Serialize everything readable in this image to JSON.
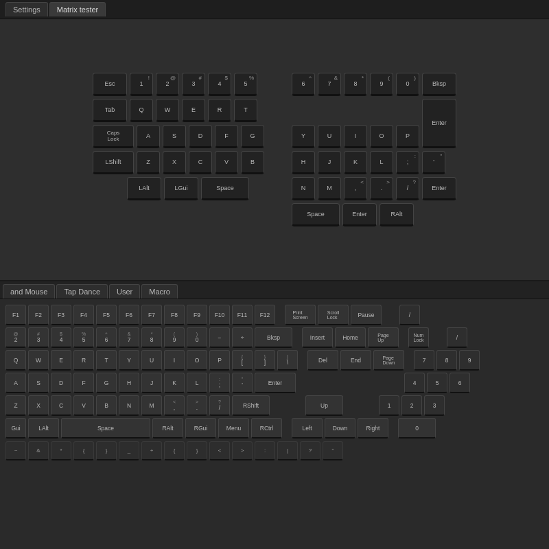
{
  "titlebar": {
    "tabs": [
      {
        "label": "Settings",
        "active": false
      },
      {
        "label": "Matrix tester",
        "active": true
      }
    ]
  },
  "bottom_tabs": [
    {
      "label": "and Mouse",
      "active": false
    },
    {
      "label": "Tap Dance",
      "active": false
    },
    {
      "label": "User",
      "active": false
    },
    {
      "label": "Macro",
      "active": false
    }
  ],
  "split_left": {
    "rows": [
      [
        "Esc",
        "!\\n1",
        "@\\n2",
        "#\\n3",
        "$\\n4",
        "%\\n5"
      ],
      [
        "Tab",
        "Q",
        "W",
        "E",
        "R"
      ],
      [
        "Caps\\nLock",
        "A",
        "S",
        "D",
        "F"
      ],
      [
        "LShift",
        "Z",
        "X",
        "C",
        "V"
      ],
      [
        "LAlt",
        "LGui",
        "Space"
      ]
    ]
  },
  "split_right": {
    "rows": [
      [
        "^\\n6",
        "&\\n7",
        "*\\n8",
        "(\\n9",
        ")\\n0",
        "Bksp"
      ],
      [
        "Y",
        "U",
        "I",
        "O",
        "P",
        "Enter"
      ],
      [
        "H",
        "J",
        "K",
        "L",
        ";\\n:",
        "\\'\\n\""
      ],
      [
        "N",
        "M",
        "<\\n,",
        ">\\n.",
        "?\\n/",
        "Enter"
      ],
      [
        "Space",
        "Enter",
        "RAlt"
      ]
    ]
  },
  "colors": {
    "bg": "#2e2e2e",
    "key_bg": "#222222",
    "key_border": "#444444",
    "active_tab": "#3a3a3a"
  }
}
